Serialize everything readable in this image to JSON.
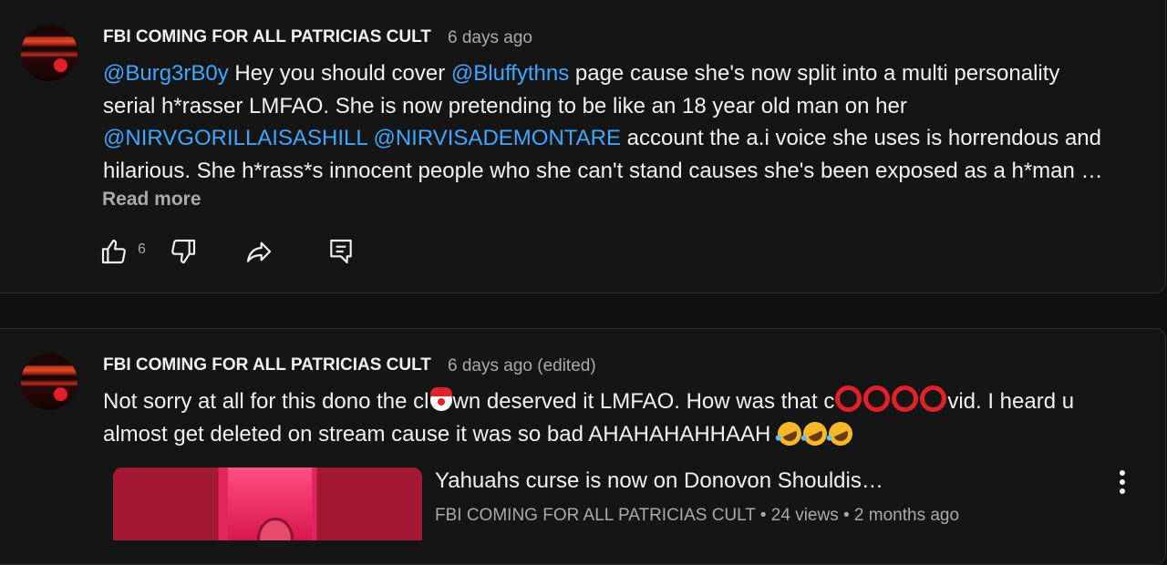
{
  "comments": [
    {
      "author": "FBI COMING FOR ALL PATRICIAS CULT",
      "time": "6 days ago",
      "lines": {
        "l1a_mention": "@Burg3rB0y",
        "l1b": " Hey you should cover ",
        "l1c_mention": "@Bluffythns",
        "l1d": " page cause she's now split into a multi personality",
        "l2": "serial h*rasser LMFAO. She is now pretending to be like an 18 year old man on her",
        "l3a_mention": "@NIRVGORILLAISASHILL",
        "l3b": " ",
        "l3c_mention": "@NIRVISADEMONTARE",
        "l3d": " account the a.i voice she uses is horrendous and",
        "l4": "hilarious. She h*rass*s innocent people who she can't stand causes she's been exposed as a h*man …"
      },
      "read_more": "Read more",
      "like_count": "6"
    },
    {
      "author": "FBI COMING FOR ALL PATRICIAS CULT",
      "time": "6 days ago (edited)",
      "lines": {
        "l1a": "Not sorry at all for this dono the cl",
        "l1b": "wn deserved it LMFAO. How was that c",
        "l1c": "vid. I heard u",
        "l2": "almost get deleted on stream cause it was so bad AHAHAHAHHAAH"
      },
      "emoji": [
        "clown-face",
        "red-circle",
        "red-circle",
        "red-circle",
        "red-circle",
        "rolling-on-floor-laughing",
        "rolling-on-floor-laughing",
        "rolling-on-floor-laughing"
      ],
      "video": {
        "title": "Yahuahs curse is now on Donovon Shouldis…",
        "channel": "FBI COMING FOR ALL PATRICIAS CULT",
        "views": "24 views",
        "age": "2 months ago"
      }
    }
  ],
  "icons": {
    "like": "thumbs-up-icon",
    "dislike": "thumbs-down-icon",
    "share": "share-icon",
    "reply": "reply-icon",
    "more": "vertical-dots-icon"
  },
  "colors": {
    "background": "#0f0f0f",
    "card": "#151515",
    "mention": "#3ea6ff",
    "secondary_text": "#aaaaaa"
  }
}
